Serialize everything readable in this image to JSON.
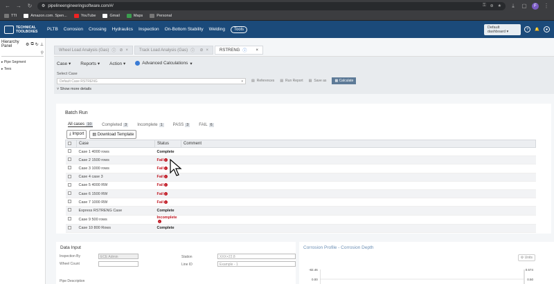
{
  "browser": {
    "url": "pipelineengineeringsoftware.com/#/",
    "profile_initial": "F",
    "bookmarks": [
      "TTI",
      "Amazon.com. Spen...",
      "YouTube",
      "Gmail",
      "Maps",
      "Personal"
    ]
  },
  "header": {
    "logo_line1": "TECHNICAL",
    "logo_line2": "TOOLBOXES",
    "menu": [
      "PLTB",
      "Corrosion",
      "Crossing",
      "Hydraulics",
      "Inspection",
      "On-Bottom Stability",
      "Welding"
    ],
    "tools_label": "Tools",
    "dashboard_select": "Default dashboard"
  },
  "left_panel": {
    "title": "Hierarchy Panel",
    "tree": [
      "Pipe Segment",
      "Tees"
    ]
  },
  "tabs": [
    {
      "label": "Wheel Load Analysis (Gas)",
      "active": false
    },
    {
      "label": "Track Load Analysis (Gas)",
      "active": false
    },
    {
      "label": "RSTRENG",
      "active": true
    }
  ],
  "toolbar": {
    "case": "Case",
    "reports": "Reports",
    "action": "Action",
    "advanced": "Advanced Calculations"
  },
  "select_case": {
    "label": "Select Case",
    "value": "Default Case RSTRENG",
    "references": "References",
    "run_report": "Run Report",
    "save_as": "Save as",
    "calculate": "Calculate",
    "show_more": "Show more details"
  },
  "batch": {
    "title": "Batch Run",
    "filters": [
      {
        "label": "All cases",
        "count": "10",
        "active": true
      },
      {
        "label": "Completed",
        "count": "3",
        "active": false
      },
      {
        "label": "Incomplete",
        "count": "1",
        "active": false
      },
      {
        "label": "PASS",
        "count": "3",
        "active": false
      },
      {
        "label": "FAIL",
        "count": "6",
        "active": false
      }
    ],
    "import_label": "Import",
    "download_label": "Download Template",
    "columns": [
      "Case",
      "Status",
      "Comment"
    ],
    "rows": [
      {
        "case": "Case 1 4000 rows",
        "status": "Complete",
        "kind": "complete"
      },
      {
        "case": "Case 2 1500 rows",
        "status": "Fail",
        "kind": "fail"
      },
      {
        "case": "Case 3 1000 rows",
        "status": "Fail",
        "kind": "fail"
      },
      {
        "case": "Case 4 case 3",
        "status": "Fail",
        "kind": "fail"
      },
      {
        "case": "Case 5 4000 RW",
        "status": "Fail",
        "kind": "fail"
      },
      {
        "case": "Case 6 1500 RW",
        "status": "Fail",
        "kind": "fail"
      },
      {
        "case": "Case 7 1000 RW",
        "status": "Fail",
        "kind": "fail"
      },
      {
        "case": "Express RSTRENG Case",
        "status": "Complete",
        "kind": "complete"
      },
      {
        "case": "Case 9 500 rows",
        "status": "Incomplete",
        "kind": "incomplete"
      },
      {
        "case": "Case 10 800 Rows",
        "status": "Complete",
        "kind": "complete"
      }
    ]
  },
  "data_input": {
    "title": "Data Input",
    "inspection_by_label": "Inspection By",
    "inspection_by_value": "ECE Admin",
    "wheel_count_label": "Wheel Count",
    "station_label": "Station",
    "station_placeholder": "XXX+22.8",
    "line_id_label": "Line ID",
    "line_id_placeholder": "Example - 1",
    "pipe_description_label": "Pipe Description"
  },
  "corrosion": {
    "title": "Corrosion Profile - Corrosion Depth",
    "units": "Units",
    "y_left": [
      "-82.46",
      "0.00"
    ],
    "y_right": [
      "0.574",
      "0.50"
    ]
  }
}
